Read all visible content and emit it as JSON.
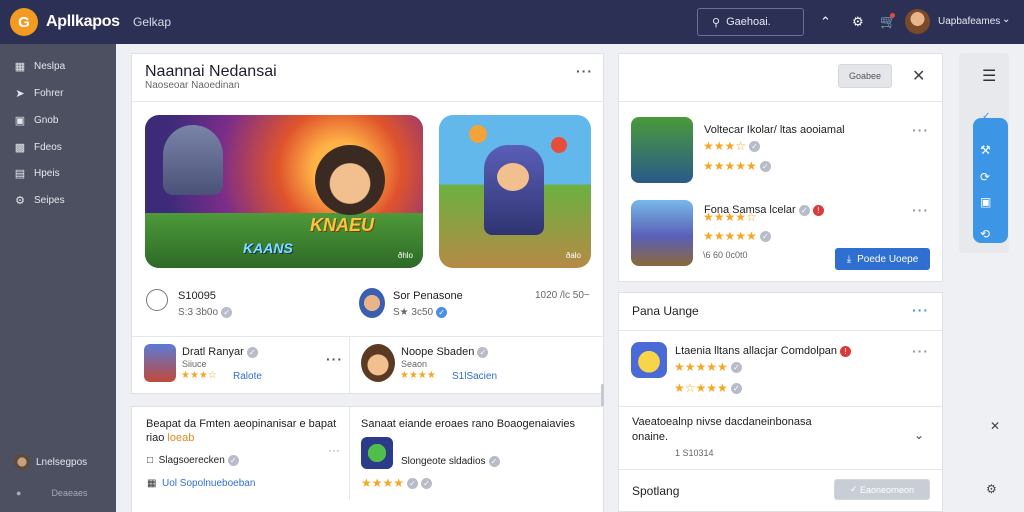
{
  "app": {
    "logo_letter": "G",
    "name": "Apllkapos",
    "nav_link": "Gelkap"
  },
  "search": {
    "label": "Gaehoai."
  },
  "user": {
    "name": "Uapbafeames"
  },
  "sidebar": {
    "items": [
      {
        "label": "Neslpa",
        "icon": "home-icon"
      },
      {
        "label": "Fohrer",
        "icon": "pin-icon"
      },
      {
        "label": "Gnob",
        "icon": "box-icon"
      },
      {
        "label": "Fdeos",
        "icon": "tag-icon"
      },
      {
        "label": "Hpeis",
        "icon": "chart-icon"
      },
      {
        "label": "Seipes",
        "icon": "gear-icon"
      }
    ],
    "footer_user": "Lnelsegpos",
    "footer_link": "Deaeaes"
  },
  "featured": {
    "title": "Naannai Nedansai",
    "subtitle": "Naoseoar Naoedinan",
    "banner1_logo": "KNAEU",
    "banner1_logo2": "KAANS",
    "banner1_tag": "ðhlo",
    "banner2_tag": "ðalo",
    "stat1_value": "S10095",
    "stat1_sub": "S:3 3b0o",
    "stat2_value": "Sor Penasone",
    "stat2_sub": "S★ 3c50",
    "stat2_right": "1020 /lc 50~"
  },
  "games_row": [
    {
      "title": "Dratl Ranyar",
      "sub": "Siiuce",
      "stars": "★★★☆",
      "link": "Ralote"
    },
    {
      "title": "Noope Sbaden",
      "sub": "Seaon",
      "stars": "★★★★",
      "link": "S1lSacien"
    }
  ],
  "news": [
    {
      "title": "Beapat da Fmten aeopinanisar e bapat",
      "title2_a": "riao",
      "title2_b": "loeab",
      "item1": "Slagsoerecken",
      "item2": "Uol  Sopolnueboeban"
    },
    {
      "title": "Sanaat eiande eroaes rano Boaogenaiavies",
      "item": "Slongeote sldadios",
      "stars": "★★★★"
    }
  ],
  "recommend": {
    "button": "Goabee",
    "items": [
      {
        "title": "Voltecar Ikolar/ ltas aooiamal",
        "stars_top": "★★★☆",
        "stars": "★★★★★"
      },
      {
        "title": "Fona Samsa lcelar",
        "stars_top": "★★★★☆",
        "stars": "★★★★★"
      }
    ],
    "price_line": "\\6 60 0c0t0",
    "cta": "Poede Uoepe"
  },
  "pana": {
    "title": "Pana Uange",
    "item_title": "Ltaenia lltans allacjar Comdolpan",
    "stars": "★★★★★",
    "stars2": "★☆★★★"
  },
  "faq": {
    "text1": "Vaeatoealnp nivse dacdaneinbonasa",
    "text2": "onaine.",
    "sub": "1 S10314"
  },
  "footer": {
    "label": "Spotlang",
    "button": "Eaoneorneon"
  },
  "colors": {
    "topbar": "#2c3054",
    "sidebar": "#4c5060",
    "accent": "#2f6fd1",
    "logo": "#f39a22",
    "star": "#f5a623"
  }
}
